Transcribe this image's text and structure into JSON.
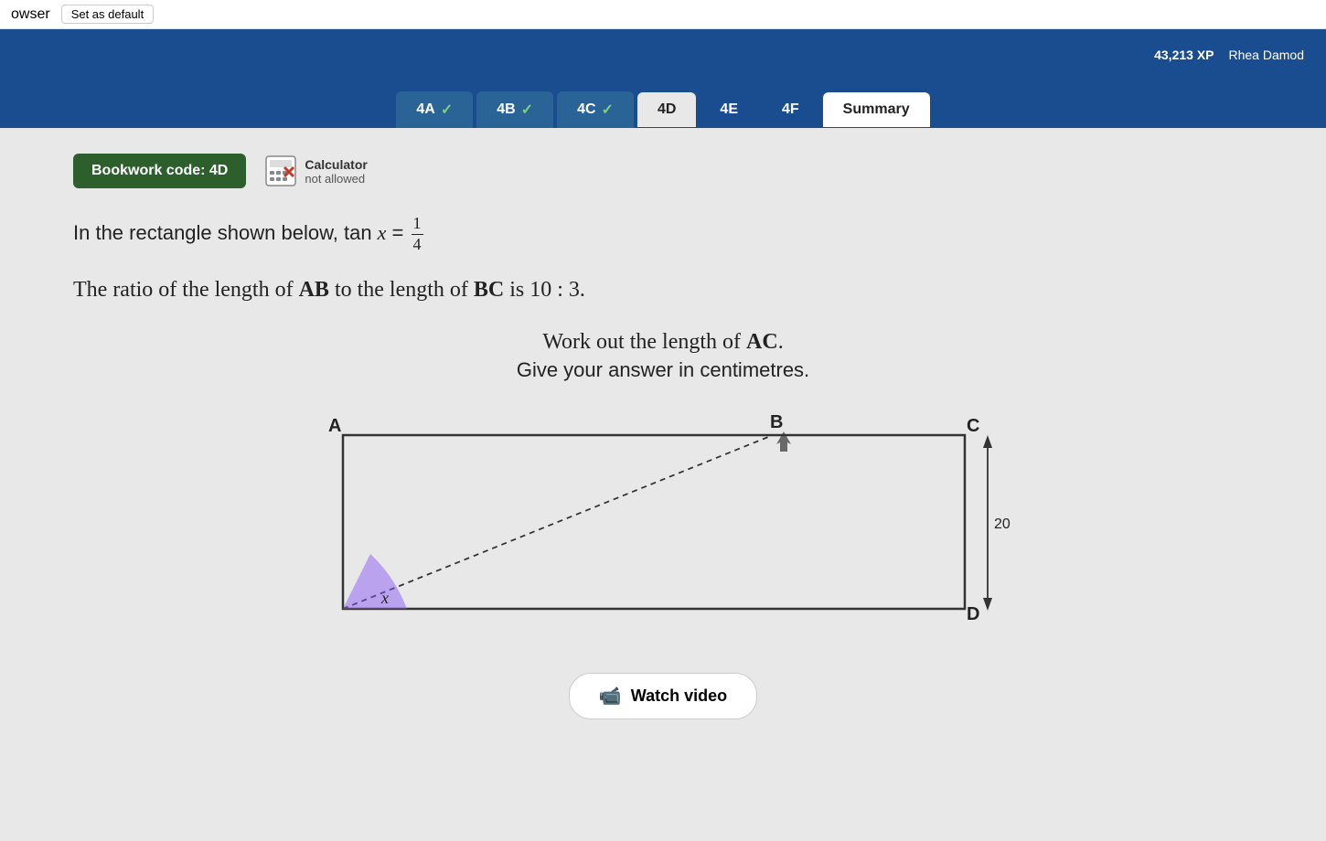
{
  "topbar": {
    "set_default_label": "Set as default",
    "browser_label": "owser"
  },
  "header": {
    "xp": "43,213 XP",
    "user": "Rhea Damod"
  },
  "tabs": [
    {
      "id": "4A",
      "label": "4A",
      "state": "completed",
      "checkmark": "✓"
    },
    {
      "id": "4B",
      "label": "4B",
      "state": "completed",
      "checkmark": "✓"
    },
    {
      "id": "4C",
      "label": "4C",
      "state": "completed",
      "checkmark": "✓"
    },
    {
      "id": "4D",
      "label": "4D",
      "state": "active"
    },
    {
      "id": "4E",
      "label": "4E",
      "state": "plain"
    },
    {
      "id": "4F",
      "label": "4F",
      "state": "plain"
    },
    {
      "id": "Summary",
      "label": "Summary",
      "state": "summary"
    }
  ],
  "bookwork": {
    "label": "Bookwork code: 4D"
  },
  "calculator": {
    "label": "Calculator",
    "sublabel": "not allowed"
  },
  "problem": {
    "line1_pre": "In the rectangle shown below, tan ",
    "line1_var": "x",
    "line1_eq": " = ",
    "fraction_num": "1",
    "fraction_den": "4",
    "line2": "The ratio of the length of AB to the length of BC is 10 : 3.",
    "line3": "Work out the length of AC.",
    "line4": "Give your answer in centimetres."
  },
  "diagram": {
    "label_A": "A",
    "label_B": "B",
    "label_C": "C",
    "label_D": "D",
    "label_x": "x",
    "dimension": "20 cm"
  },
  "watch_video": {
    "label": "Watch video"
  }
}
